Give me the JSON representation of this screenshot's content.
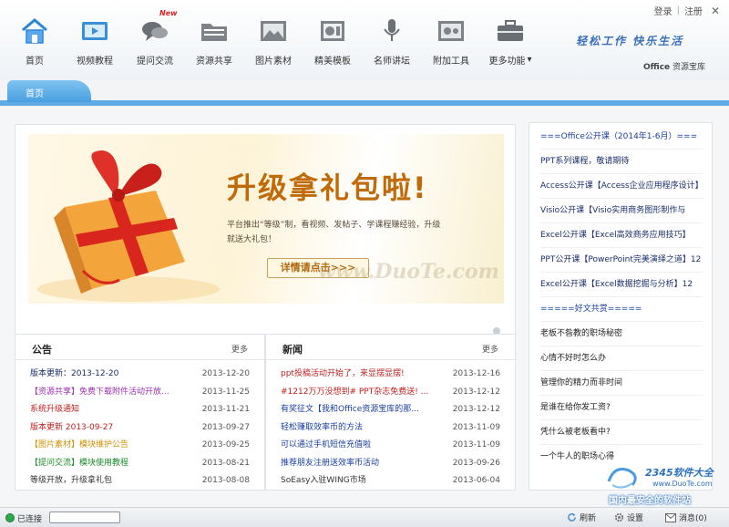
{
  "top_links": {
    "login": "登录",
    "sep": "|",
    "register": "注册",
    "close": "✕"
  },
  "slogan": "轻松工作 快乐生活",
  "brand": {
    "office": "Office",
    "label": "资源宝库"
  },
  "toolbar": {
    "new_badge": "New",
    "items": [
      {
        "label": "首页",
        "icon": "home-icon"
      },
      {
        "label": "视频教程",
        "icon": "video-icon"
      },
      {
        "label": "提问交流",
        "icon": "chat-icon"
      },
      {
        "label": "资源共享",
        "icon": "folder-icon"
      },
      {
        "label": "图片素材",
        "icon": "picture-icon"
      },
      {
        "label": "精美模板",
        "icon": "template-icon"
      },
      {
        "label": "名师讲坛",
        "icon": "microphone-icon"
      },
      {
        "label": "附加工具",
        "icon": "tools-icon"
      },
      {
        "label": "更多功能",
        "icon": "briefcase-icon",
        "arrow": "▾"
      }
    ]
  },
  "tab": {
    "home": "首页"
  },
  "banner": {
    "title": "升级拿礼包啦!",
    "subtitle": "平台推出“等级”制，看视频、发帖子、学课程赚经验，升级就送大礼包！",
    "button": "详情请点击>>>",
    "watermark": "www.DuoTe.com"
  },
  "notice": {
    "title": "公告",
    "more": "更多",
    "items": [
      {
        "text": "版本更新：2013-12-20",
        "date": "2013-12-20",
        "color": "#1a2e6b"
      },
      {
        "text": "【资源共享】免费下载附件活动开放...",
        "date": "2013-11-25",
        "color": "#9b30b0"
      },
      {
        "text": "系统升级通知",
        "date": "2013-11-21",
        "color": "#c02020"
      },
      {
        "text": "版本更新 2013-09-27",
        "date": "2013-09-27",
        "color": "#c02020"
      },
      {
        "text": "【图片素材】模块维护公告",
        "date": "2013-09-25",
        "color": "#d09000"
      },
      {
        "text": "【提问交流】模块使用教程",
        "date": "2013-08-21",
        "color": "#1a8a2a"
      },
      {
        "text": "等级开放，升级拿礼包",
        "date": "2013-08-08",
        "color": "#333333"
      }
    ]
  },
  "news": {
    "title": "新闻",
    "more": "更多",
    "items": [
      {
        "text": "ppt投稿活动开始了，来显摆显摆!",
        "date": "2013-12-16",
        "color": "#c02020"
      },
      {
        "text": "#1212万万没想到# PPT杂志免费送! ...",
        "date": "2013-12-12",
        "color": "#c02020"
      },
      {
        "text": "有奖征文【我和Office资源宝库的那...",
        "date": "2013-12-12",
        "color": "#1a3ea0"
      },
      {
        "text": "轻松赚取效率币的方法",
        "date": "2013-11-09",
        "color": "#1a3ea0"
      },
      {
        "text": "可以通过手机短信充值啦",
        "date": "2013-11-09",
        "color": "#1a3ea0"
      },
      {
        "text": "推荐朋友注册送效率币活动",
        "date": "2013-09-26",
        "color": "#1a3ea0"
      },
      {
        "text": "SoEasy入驻WING市场",
        "date": "2013-06-04",
        "color": "#333333"
      }
    ]
  },
  "sidebar": {
    "items": [
      {
        "text": "===Office公开课（2014年1-6月）===",
        "kind": "head"
      },
      {
        "text": "PPT系列课程，敬请期待",
        "kind": "link"
      },
      {
        "text": "Access公开课【Access企业应用程序设计】",
        "kind": "link"
      },
      {
        "text": "Visio公开课【Visio实用商务图形制作与",
        "kind": "link"
      },
      {
        "text": "Excel公开课【Excel高效商务应用技巧】",
        "kind": "link"
      },
      {
        "text": "PPT公开课【PowerPoint完美演绎之道】12",
        "kind": "link"
      },
      {
        "text": "Excel公开课【Excel数据挖掘与分析】12",
        "kind": "link"
      },
      {
        "text": "=====好文共赏=====",
        "kind": "head"
      },
      {
        "text": "老板不昝教的职场秘密",
        "kind": "norm"
      },
      {
        "text": "心情不好时怎么办",
        "kind": "norm"
      },
      {
        "text": "管理你的精力而非时间",
        "kind": "norm"
      },
      {
        "text": "是谁在给你发工资?",
        "kind": "norm"
      },
      {
        "text": "凭什么被老板看中?",
        "kind": "norm"
      },
      {
        "text": "一个牛人的职场心得",
        "kind": "norm"
      }
    ]
  },
  "watermark_logo": {
    "brand": "2345软件大全",
    "url": "www.DuoTe.com",
    "tagline": "国内最安全的软件站"
  },
  "statusbar": {
    "connected": "已连接",
    "refresh": "刷新",
    "settings": "设置",
    "messages": "消息(0)"
  }
}
